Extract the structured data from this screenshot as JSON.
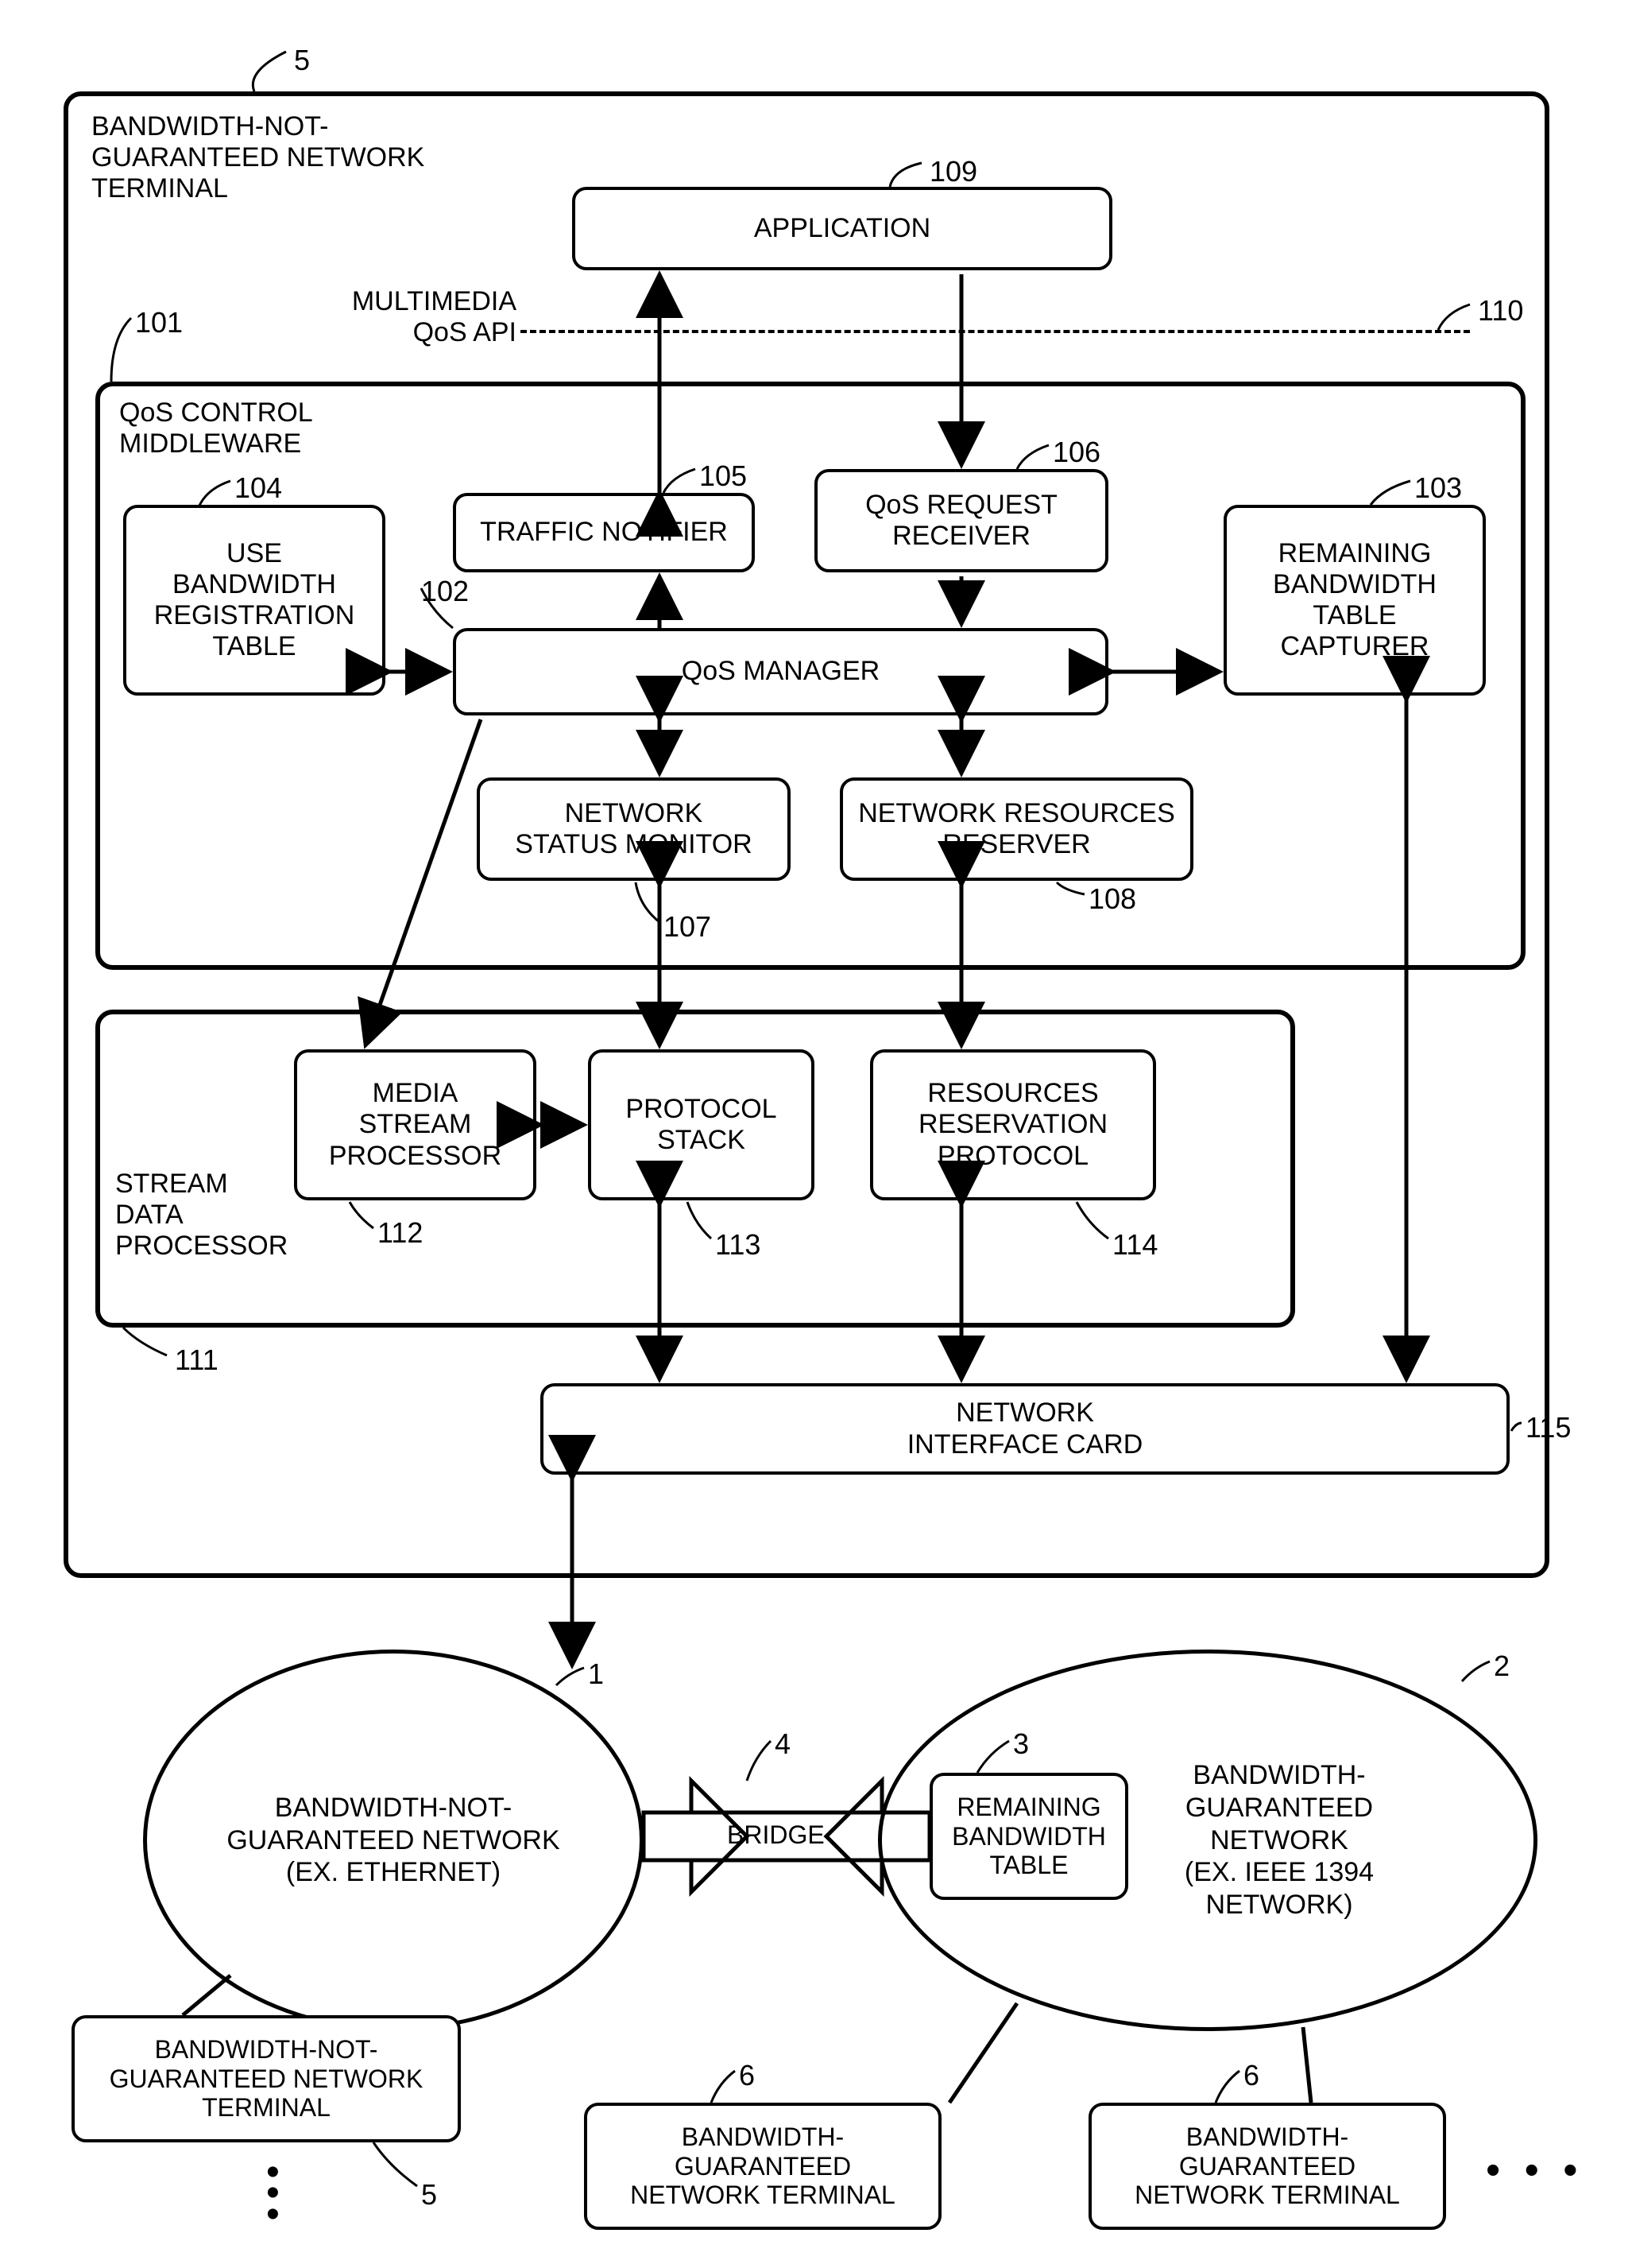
{
  "outer": {
    "label": "BANDWIDTH-NOT-\nGUARANTEED NETWORK\nTERMINAL",
    "num": "5"
  },
  "middleware": {
    "label": "QoS CONTROL\nMIDDLEWARE",
    "num": "101",
    "apiLabel": "MULTIMEDIA\nQoS API",
    "apiNum": "110"
  },
  "blocks": {
    "application": {
      "label": "APPLICATION",
      "num": "109"
    },
    "useBandwidth": {
      "label": "USE\nBANDWIDTH\nREGISTRATION\nTABLE",
      "num": "104"
    },
    "trafficNotifier": {
      "label": "TRAFFIC NOTIFIER",
      "num": "105"
    },
    "qosRequestReceiver": {
      "label": "QoS REQUEST\nRECEIVER",
      "num": "106"
    },
    "remainingCapturer": {
      "label": "REMAINING\nBANDWIDTH\nTABLE\nCAPTURER",
      "num": "103"
    },
    "qosManager": {
      "label": "QoS MANAGER",
      "num": "102"
    },
    "networkStatusMonitor": {
      "label": "NETWORK\nSTATUS MONITOR",
      "num": "107"
    },
    "networkResourcesReserver": {
      "label": "NETWORK RESOURCES\nRESERVER",
      "num": "108"
    },
    "mediaStreamProcessor": {
      "label": "MEDIA\nSTREAM\nPROCESSOR",
      "num": "112"
    },
    "protocolStack": {
      "label": "PROTOCOL\nSTACK",
      "num": "113"
    },
    "resourcesReservationProtocol": {
      "label": "RESOURCES\nRESERVATION\nPROTOCOL",
      "num": "114"
    },
    "streamDataProcessor": {
      "label": "STREAM\nDATA\nPROCESSOR",
      "num": "111"
    },
    "nic": {
      "label": "NETWORK\nINTERFACE CARD",
      "num": "115"
    }
  },
  "networks": {
    "bng1": {
      "label": "BANDWIDTH-NOT-\nGUARANTEED NETWORK\n(EX. ETHERNET)",
      "num": "1"
    },
    "bg2": {
      "label": "BANDWIDTH-\nGUARANTEED\nNETWORK\n(EX. IEEE 1394\nNETWORK)",
      "num": "2"
    },
    "bridge": {
      "label": "BRIDGE",
      "num": "4"
    },
    "remTable": {
      "label": "REMAINING\nBANDWIDTH\nTABLE",
      "num": "3"
    },
    "bngTerm": {
      "label": "BANDWIDTH-NOT-\nGUARANTEED NETWORK\nTERMINAL",
      "num": "5"
    },
    "bgTerm1": {
      "label": "BANDWIDTH-\nGUARANTEED\nNETWORK TERMINAL",
      "num": "6"
    },
    "bgTerm2": {
      "label": "BANDWIDTH-\nGUARANTEED\nNETWORK TERMINAL",
      "num": "6"
    },
    "dots": ". . ."
  }
}
